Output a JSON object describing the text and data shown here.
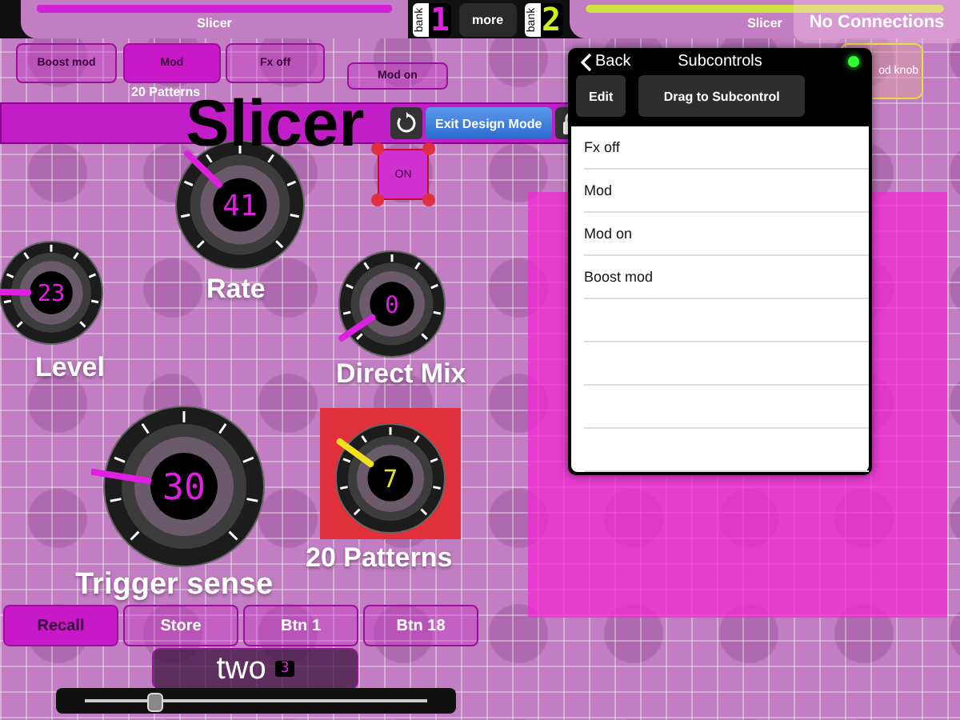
{
  "top_bar": {
    "left_title": "Slicer",
    "left_bar": {
      "level": 1
    },
    "right_title": "Slicer",
    "right_bar": {
      "level": 1
    },
    "banks": [
      {
        "label": "bank",
        "number": "1",
        "color": "#e020e0"
      },
      {
        "label": "bank",
        "number": "2",
        "color": "#c8f020"
      }
    ],
    "more_button": "more",
    "status": "No Connections"
  },
  "subcontrol_buttons": [
    {
      "label": "Boost mod",
      "selected": false
    },
    {
      "label": "Mod",
      "selected": true
    },
    {
      "label": "Fx off",
      "selected": false
    },
    {
      "label": "Mod on",
      "selected": false
    }
  ],
  "mod_caption": "20 Patterns",
  "title": "Slicer",
  "design_toolbar": {
    "exit_button": "Exit Design Mode",
    "locked": true
  },
  "toggle": {
    "label": "ON",
    "selected": true
  },
  "mod_knob_label": "od knob",
  "knobs": [
    {
      "label": "Level",
      "value": "23",
      "level": 0.17,
      "color": "#e020e0"
    },
    {
      "label": "Rate",
      "value": "41",
      "level": 0.33,
      "color": "#e020e0"
    },
    {
      "label": "Direct Mix",
      "value": "0",
      "level": 0.04,
      "color": "#e020e0"
    },
    {
      "label": "Trigger sense",
      "value": "30",
      "level": 0.2,
      "color": "#e020e0"
    },
    {
      "label": "20 Patterns",
      "value": "7",
      "level": 0.3,
      "color": "#f0e020"
    }
  ],
  "pad_buttons": [
    {
      "label": "Recall",
      "selected": true
    },
    {
      "label": "Store",
      "selected": false
    },
    {
      "label": "Btn 1",
      "selected": false
    },
    {
      "label": "Btn 18",
      "selected": false
    }
  ],
  "slider": {
    "label": "two",
    "value": "3",
    "level": 0.2
  },
  "popup": {
    "back": "Back",
    "title": "Subcontrols",
    "connected": true,
    "edit_button": "Edit",
    "drag_button": "Drag to Subcontrol",
    "items": [
      "Fx off",
      "Mod",
      "Mod on",
      "Boost mod"
    ]
  }
}
